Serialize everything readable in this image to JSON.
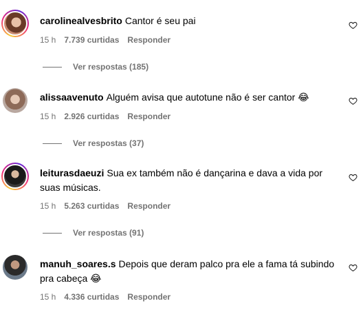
{
  "comments": [
    {
      "username": "carolinealvesbrito",
      "text": "Cantor é seu pai",
      "emoji": "",
      "time": "15 h",
      "likes": "7.739 curtidas",
      "reply_label": "Responder",
      "replies_label": "Ver respostas (185)"
    },
    {
      "username": "alissaavenuto",
      "text": "Alguém avisa que autotune não é ser cantor",
      "emoji": "😂",
      "time": "15 h",
      "likes": "2.926 curtidas",
      "reply_label": "Responder",
      "replies_label": "Ver respostas (37)"
    },
    {
      "username": "leiturasdaeuzi",
      "text": "Sua ex também não é dançarina e dava a vida por suas músicas.",
      "emoji": "",
      "time": "15 h",
      "likes": "5.263 curtidas",
      "reply_label": "Responder",
      "replies_label": "Ver respostas (91)"
    },
    {
      "username": "manuh_soares.s",
      "text": "Depois que deram palco pra ele a fama tá subindo pra cabeça",
      "emoji": "😂",
      "time": "15 h",
      "likes": "4.336 curtidas",
      "reply_label": "Responder",
      "replies_label": ""
    }
  ],
  "icons": {
    "like": "heart-outline-icon"
  },
  "colors": {
    "meta": "#737373",
    "text": "#000000"
  }
}
